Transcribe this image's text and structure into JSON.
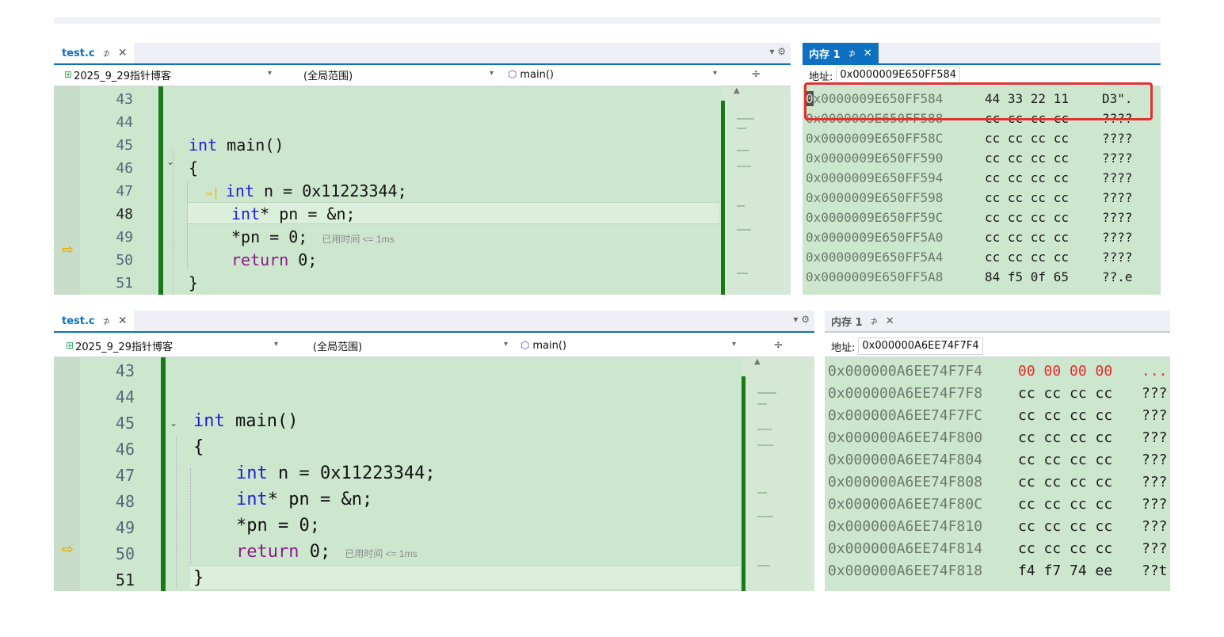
{
  "shot1": {
    "editor_tab": {
      "title": "test.c",
      "pin": "⊅",
      "close": "✕"
    },
    "nav": {
      "project": "2025_9_29指针博客",
      "scope": "(全局范围)",
      "func": "main()"
    },
    "code_lines": [
      {
        "num": "43",
        "text": ""
      },
      {
        "num": "44",
        "text": ""
      },
      {
        "num": "45",
        "text": "int main()"
      },
      {
        "num": "46",
        "text": "{"
      },
      {
        "num": "47",
        "text": "int n = 0x11223344;"
      },
      {
        "num": "48",
        "text": "int* pn = &n;"
      },
      {
        "num": "49",
        "text": "*pn = 0;"
      },
      {
        "num": "50",
        "text": "return 0;"
      },
      {
        "num": "51",
        "text": "}"
      }
    ],
    "elapsed": "已用时间 <= 1ms",
    "memory": {
      "tab": "内存 1",
      "address_label": "地址:",
      "address_value": "0x0000009E650FF584",
      "rows": [
        {
          "addr": "0x0000009E650FF584",
          "bytes": "44 33 22 11",
          "ascii": "D3\"."
        },
        {
          "addr": "0x0000009E650FF588",
          "bytes": "cc cc cc cc",
          "ascii": "????"
        },
        {
          "addr": "0x0000009E650FF58C",
          "bytes": "cc cc cc cc",
          "ascii": "????"
        },
        {
          "addr": "0x0000009E650FF590",
          "bytes": "cc cc cc cc",
          "ascii": "????"
        },
        {
          "addr": "0x0000009E650FF594",
          "bytes": "cc cc cc cc",
          "ascii": "????"
        },
        {
          "addr": "0x0000009E650FF598",
          "bytes": "cc cc cc cc",
          "ascii": "????"
        },
        {
          "addr": "0x0000009E650FF59C",
          "bytes": "cc cc cc cc",
          "ascii": "????"
        },
        {
          "addr": "0x0000009E650FF5A0",
          "bytes": "cc cc cc cc",
          "ascii": "????"
        },
        {
          "addr": "0x0000009E650FF5A4",
          "bytes": "cc cc cc cc",
          "ascii": "????"
        },
        {
          "addr": "0x0000009E650FF5A8",
          "bytes": "84 f5 0f 65",
          "ascii": "??.e"
        }
      ]
    }
  },
  "shot2": {
    "editor_tab": {
      "title": "test.c",
      "pin": "⊅",
      "close": "✕"
    },
    "nav": {
      "project": "2025_9_29指针博客",
      "scope": "(全局范围)",
      "func": "main()"
    },
    "code_lines": [
      {
        "num": "43",
        "text": ""
      },
      {
        "num": "44",
        "text": ""
      },
      {
        "num": "45",
        "text": "int main()"
      },
      {
        "num": "46",
        "text": "{"
      },
      {
        "num": "47",
        "text": "int n = 0x11223344;"
      },
      {
        "num": "48",
        "text": "int* pn = &n;"
      },
      {
        "num": "49",
        "text": "*pn = 0;"
      },
      {
        "num": "50",
        "text": "return 0;"
      },
      {
        "num": "51",
        "text": "}"
      }
    ],
    "elapsed": "已用时间 <= 1ms",
    "memory": {
      "tab": "内存 1",
      "address_label": "地址:",
      "address_value": "0x000000A6EE74F7F4",
      "rows": [
        {
          "addr": "0x000000A6EE74F7F4",
          "bytes": "00 00 00 00",
          "ascii": "...",
          "changed": true
        },
        {
          "addr": "0x000000A6EE74F7F8",
          "bytes": "cc cc cc cc",
          "ascii": "???"
        },
        {
          "addr": "0x000000A6EE74F7FC",
          "bytes": "cc cc cc cc",
          "ascii": "???"
        },
        {
          "addr": "0x000000A6EE74F800",
          "bytes": "cc cc cc cc",
          "ascii": "???"
        },
        {
          "addr": "0x000000A6EE74F804",
          "bytes": "cc cc cc cc",
          "ascii": "???"
        },
        {
          "addr": "0x000000A6EE74F808",
          "bytes": "cc cc cc cc",
          "ascii": "???"
        },
        {
          "addr": "0x000000A6EE74F80C",
          "bytes": "cc cc cc cc",
          "ascii": "???"
        },
        {
          "addr": "0x000000A6EE74F810",
          "bytes": "cc cc cc cc",
          "ascii": "???"
        },
        {
          "addr": "0x000000A6EE74F814",
          "bytes": "cc cc cc cc",
          "ascii": "???"
        },
        {
          "addr": "0x000000A6EE74F818",
          "bytes": "f4 f7 74 ee",
          "ascii": "??t"
        }
      ]
    }
  },
  "colors": {
    "editor_bg": "#cde7cf",
    "accent": "#0e70c0",
    "keyword": "#1f1fd0",
    "return_keyword": "#8b1a8b",
    "changed_bytes": "#e52b2b",
    "highlight_box": "#e03030",
    "exec_arrow": "#e0b000"
  },
  "icons": {
    "pin": "pin-icon",
    "close": "close-icon",
    "dropdown": "chevron-down-icon",
    "settings": "gear-icon",
    "split": "split-view-icon",
    "next_statement": "instruction-pointer-icon",
    "project": "project-icon",
    "method": "method-cube-icon"
  }
}
